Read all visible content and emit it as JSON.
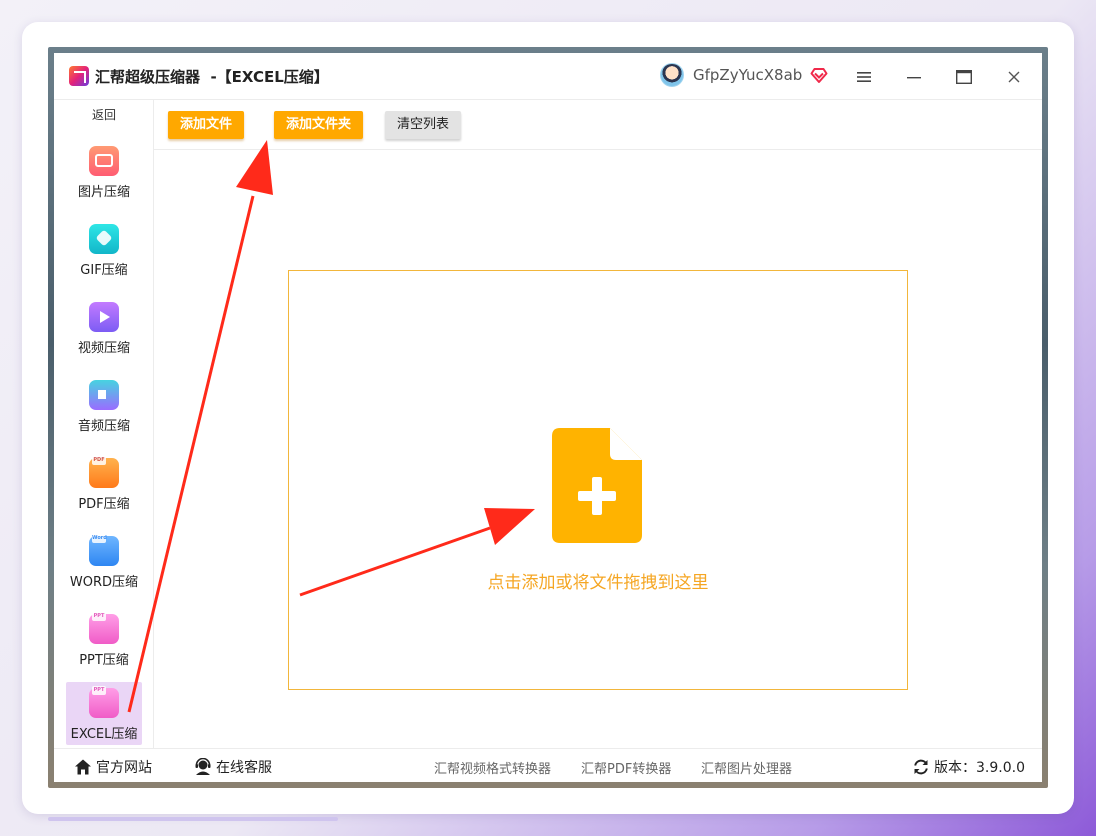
{
  "app": {
    "title": "汇帮超级压缩器  -【EXCEL压缩】",
    "username": "GfpZyYucX8ab"
  },
  "sidebar": {
    "back_label": "返回",
    "items": [
      {
        "label": "图片压缩",
        "icon": "image-compress-icon"
      },
      {
        "label": "GIF压缩",
        "icon": "gif-compress-icon"
      },
      {
        "label": "视频压缩",
        "icon": "video-compress-icon"
      },
      {
        "label": "音频压缩",
        "icon": "audio-compress-icon"
      },
      {
        "label": "PDF压缩",
        "icon": "pdf-compress-icon",
        "tag": "PDF"
      },
      {
        "label": "WORD压缩",
        "icon": "word-compress-icon",
        "tag": "Word"
      },
      {
        "label": "PPT压缩",
        "icon": "ppt-compress-icon",
        "tag": "PPT"
      },
      {
        "label": "EXCEL压缩",
        "icon": "excel-compress-icon",
        "tag": "PPT",
        "active": true
      }
    ]
  },
  "toolbar": {
    "add_file": "添加文件",
    "add_folder": "添加文件夹",
    "clear_list": "清空列表"
  },
  "drop_zone": {
    "hint": "点击添加或将文件拖拽到这里"
  },
  "footer": {
    "official_site": "官方网站",
    "online_support": "在线客服",
    "links": [
      "汇帮视频格式转换器",
      "汇帮PDF转换器",
      "汇帮图片处理器"
    ],
    "version": "版本：3.9.0.0"
  },
  "colors": {
    "accent_orange": "#ffa800",
    "drop_text": "#f5a623",
    "annotation_arrow": "#ff2a1a"
  }
}
